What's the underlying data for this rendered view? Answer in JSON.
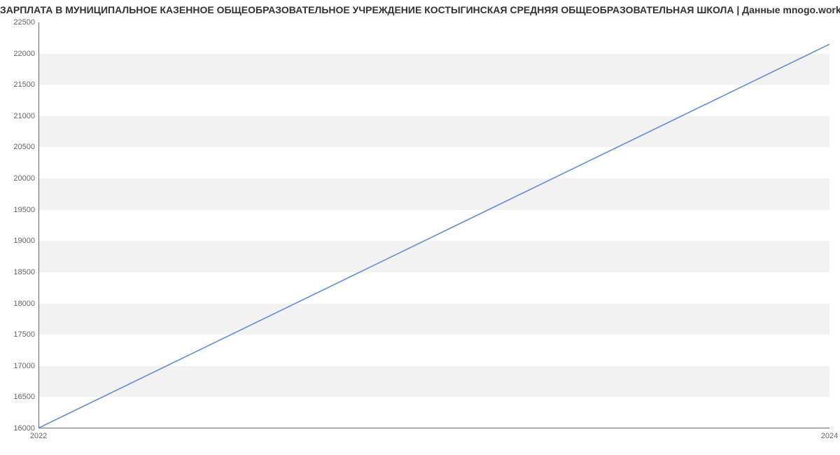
{
  "chart_data": {
    "type": "line",
    "title": "ЗАРПЛАТА В МУНИЦИПАЛЬНОЕ КАЗЕННОЕ ОБЩЕОБРАЗОВАТЕЛЬНОЕ УЧРЕЖДЕНИЕ КОСТЫГИНСКАЯ СРЕДНЯЯ ОБЩЕОБРАЗОВАТЕЛЬНАЯ ШКОЛА | Данные mnogo.work",
    "xlabel": "",
    "ylabel": "",
    "x": [
      2022,
      2024
    ],
    "values": [
      16000,
      22150
    ],
    "xlim": [
      2022,
      2024
    ],
    "ylim": [
      16000,
      22500
    ],
    "y_ticks": [
      16000,
      16500,
      17000,
      17500,
      18000,
      18500,
      19000,
      19500,
      20000,
      20500,
      21000,
      21500,
      22000,
      22500
    ],
    "x_ticks": [
      2022,
      2024
    ],
    "line_color": "#6b8fd4",
    "band_color": "#f2f2f2"
  }
}
